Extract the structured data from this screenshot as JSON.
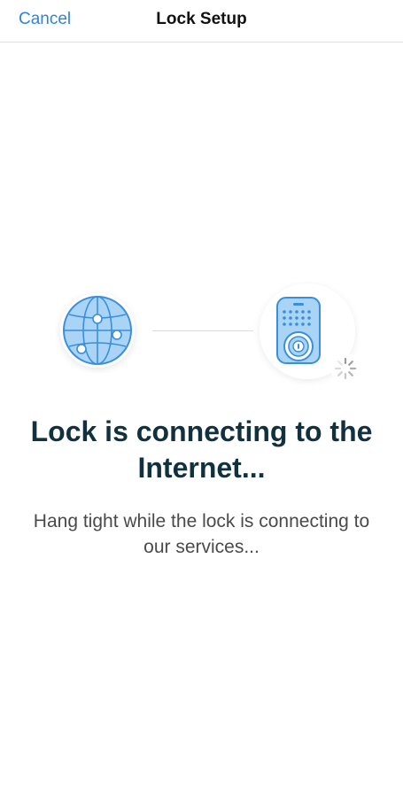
{
  "navbar": {
    "cancel_label": "Cancel",
    "title": "Lock Setup"
  },
  "illustration": {
    "left_icon": "globe-icon",
    "right_icon": "smart-lock-icon",
    "status_icon": "loading-spinner-icon"
  },
  "content": {
    "heading": "Lock is connecting to the Internet...",
    "subtext": "Hang tight while the lock is connecting to our services..."
  },
  "colors": {
    "accent": "#2c83e6",
    "heading": "#12313e",
    "body_text": "#4a4a4a",
    "icon_fill": "#a9d4f5",
    "icon_stroke": "#3a8fdc"
  }
}
